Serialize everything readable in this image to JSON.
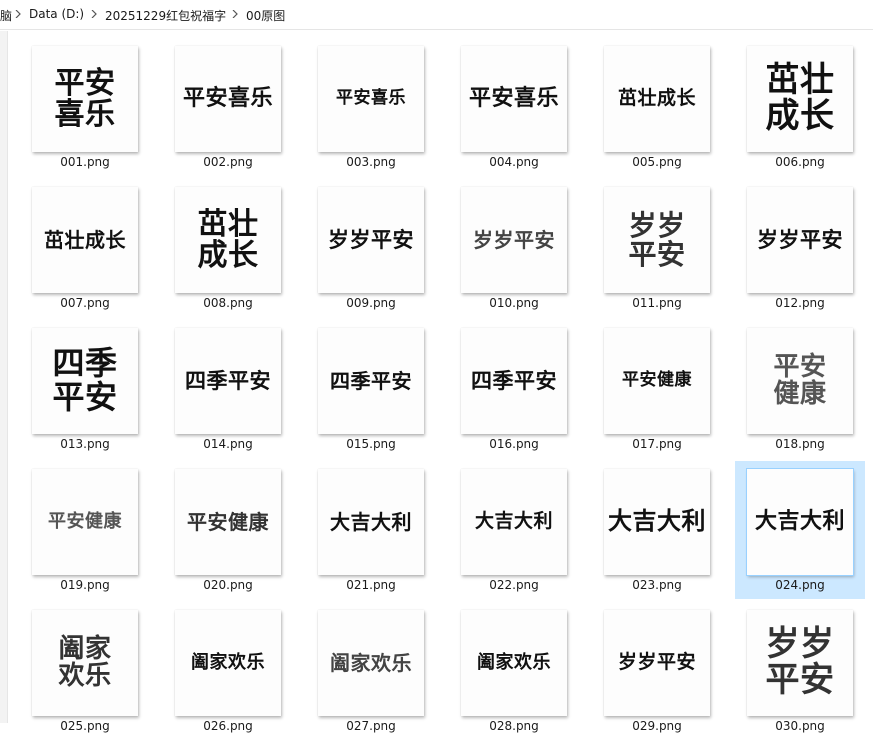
{
  "breadcrumb": {
    "root": "脑",
    "items": [
      "Data (D:)",
      "20251229红包祝福字",
      "00原图"
    ]
  },
  "files": [
    {
      "name": "001.png",
      "text": "平安\n喜乐",
      "size": 30,
      "color": "#111111"
    },
    {
      "name": "002.png",
      "text": "平安喜乐",
      "size": 22,
      "color": "#111111"
    },
    {
      "name": "003.png",
      "text": "平安喜乐",
      "size": 17,
      "color": "#111111"
    },
    {
      "name": "004.png",
      "text": "平安喜乐",
      "size": 22,
      "color": "#111111"
    },
    {
      "name": "005.png",
      "text": "茁壮成长",
      "size": 19,
      "color": "#111111"
    },
    {
      "name": "006.png",
      "text": "茁壮\n成长",
      "size": 34,
      "color": "#111111"
    },
    {
      "name": "007.png",
      "text": "茁壮成长",
      "size": 20,
      "color": "#111111"
    },
    {
      "name": "008.png",
      "text": "茁壮\n成长",
      "size": 30,
      "color": "#111111"
    },
    {
      "name": "009.png",
      "text": "岁岁平安",
      "size": 21,
      "color": "#111111"
    },
    {
      "name": "010.png",
      "text": "岁岁平安",
      "size": 20,
      "color": "#444444"
    },
    {
      "name": "011.png",
      "text": "岁岁\n平安",
      "size": 28,
      "color": "#333333"
    },
    {
      "name": "012.png",
      "text": "岁岁平安",
      "size": 21,
      "color": "#111111"
    },
    {
      "name": "013.png",
      "text": "四季\n平安",
      "size": 32,
      "color": "#111111"
    },
    {
      "name": "014.png",
      "text": "四季平安",
      "size": 21,
      "color": "#111111"
    },
    {
      "name": "015.png",
      "text": "四季平安",
      "size": 20,
      "color": "#111111"
    },
    {
      "name": "016.png",
      "text": "四季平安",
      "size": 21,
      "color": "#111111"
    },
    {
      "name": "017.png",
      "text": "平安健康",
      "size": 17,
      "color": "#111111"
    },
    {
      "name": "018.png",
      "text": "平安\n健康",
      "size": 26,
      "color": "#555555"
    },
    {
      "name": "019.png",
      "text": "平安健康",
      "size": 18,
      "color": "#555555"
    },
    {
      "name": "020.png",
      "text": "平安健康",
      "size": 20,
      "color": "#333333"
    },
    {
      "name": "021.png",
      "text": "大吉大利",
      "size": 20,
      "color": "#111111"
    },
    {
      "name": "022.png",
      "text": "大吉大利",
      "size": 19,
      "color": "#111111"
    },
    {
      "name": "023.png",
      "text": "大吉大利",
      "size": 24,
      "color": "#111111"
    },
    {
      "name": "024.png",
      "text": "大吉大利",
      "size": 22,
      "color": "#111111",
      "selected": true
    },
    {
      "name": "025.png",
      "text": "阖家\n欢乐",
      "size": 26,
      "color": "#333333"
    },
    {
      "name": "026.png",
      "text": "阖家欢乐",
      "size": 18,
      "color": "#111111"
    },
    {
      "name": "027.png",
      "text": "阖家欢乐",
      "size": 20,
      "color": "#444444"
    },
    {
      "name": "028.png",
      "text": "阖家欢乐",
      "size": 18,
      "color": "#111111"
    },
    {
      "name": "029.png",
      "text": "岁岁平安",
      "size": 19,
      "color": "#111111"
    },
    {
      "name": "030.png",
      "text": "岁岁\n平安",
      "size": 34,
      "color": "#333333"
    }
  ]
}
